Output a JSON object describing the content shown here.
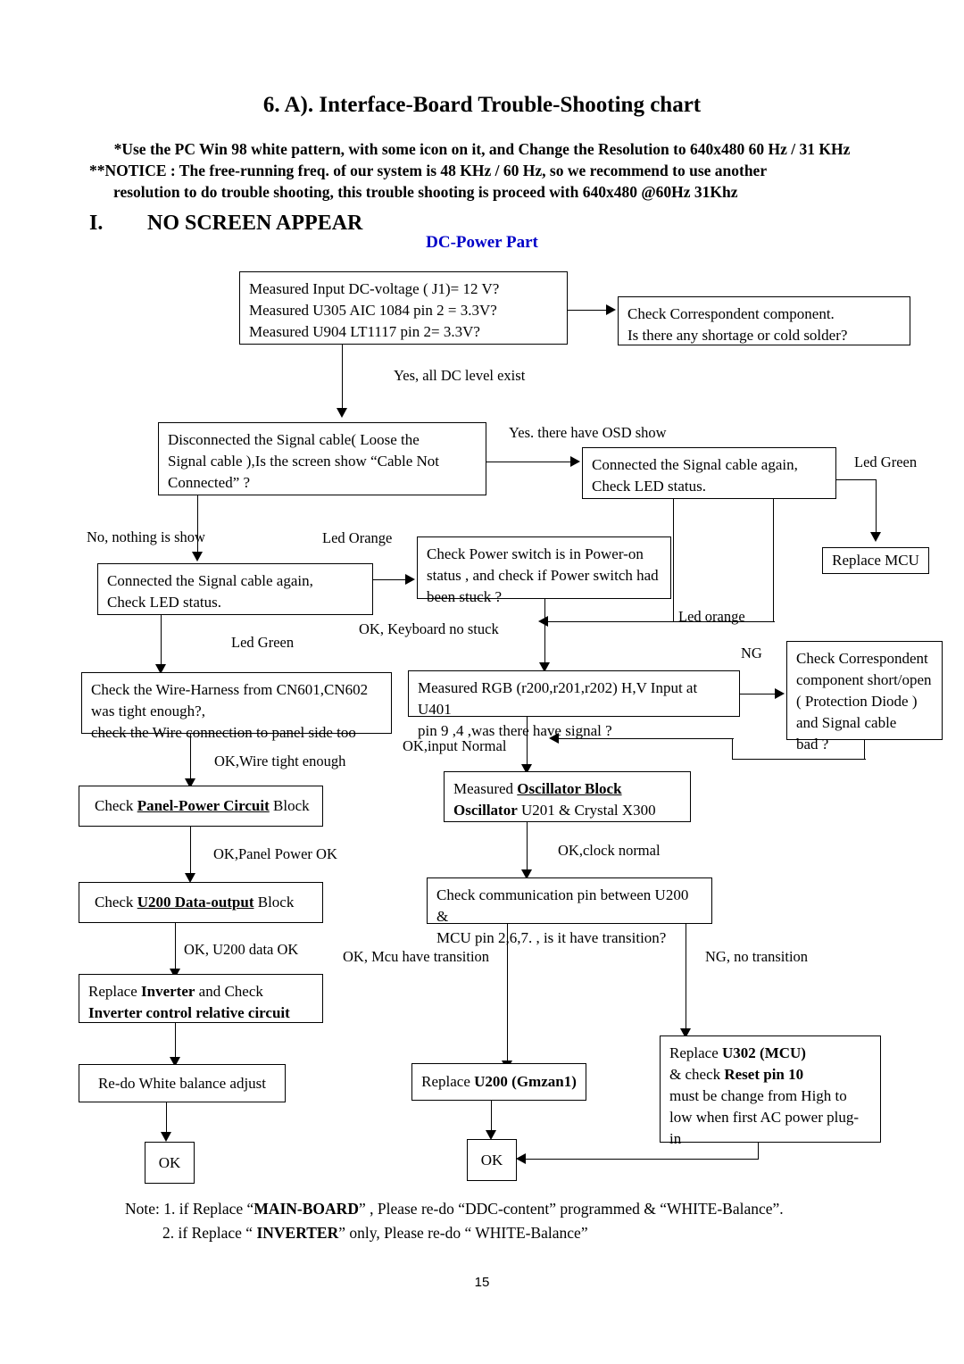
{
  "header": {
    "title": "6. A). Interface-Board Trouble-Shooting chart",
    "notice_line1": "*Use the PC Win 98 white pattern, with some icon on it, and Change the Resolution to 640x480 60 Hz / 31 KHz",
    "notice_line2": "**NOTICE : The free-running freq. of our system is 48 KHz / 60 Hz, so we recommend to use another",
    "notice_line3": "resolution to do trouble shooting, this trouble shooting is proceed with 640x480 @60Hz 31Khz",
    "section_number": "I.",
    "section_title": "NO SCREEN APPEAR",
    "subheading": "DC-Power Part",
    "subheading_color": "#0000c8"
  },
  "boxes": {
    "measured_input": {
      "line1": "Measured Input DC-voltage ( J1)= 12 V?",
      "line2": "Measured U305 AIC 1084 pin 2 = 3.3V?",
      "line3": "Measured U904 LT1117 pin 2= 3.3V?"
    },
    "check_correspondent": {
      "line1": "Check Correspondent component.",
      "line2": "Is there any shortage or cold solder?"
    },
    "disconnect_signal": {
      "line1": "Disconnected the Signal cable( Loose the",
      "line2": "Signal cable ),Is the screen show “Cable Not",
      "line3": "Connected” ?"
    },
    "connect_again_right": {
      "line1": "Connected the Signal cable again,",
      "line2": "Check LED status."
    },
    "replace_mcu": {
      "label": "Replace MCU"
    },
    "connect_again_left": {
      "line1": "Connected the Signal cable again,",
      "line2": "Check LED status."
    },
    "check_power_switch": {
      "line1": "Check Power switch is in Power-on",
      "line2": "status , and check if Power switch had",
      "line3": "been stuck ?"
    },
    "check_wire_harness": {
      "line1": "Check the Wire-Harness from CN601,CN602",
      "line2": "was tight enough?,",
      "line3": "check the Wire connection to panel side too"
    },
    "measured_rgb": {
      "line1": "Measured RGB (r200,r201,r202) H,V Input at U401",
      "line2": "pin 9 ,4 ,was there have signal ?"
    },
    "check_correspondent_short": {
      "line1": "Check Correspondent",
      "line2": "component short/open",
      "line3": " ( Protection Diode )",
      "line4": "and Signal cable",
      "line5": "bad ?"
    },
    "check_panel_power": {
      "prefix": "Check ",
      "emphasis": "Panel-Power Circuit",
      "suffix": " Block"
    },
    "measured_oscillator": {
      "line1_prefix": "Measured ",
      "line1_emphasis": "Oscillator Block",
      "line2_emphasis": "Oscillator",
      "line2_suffix": " U201 & Crystal X300"
    },
    "check_u200_data": {
      "prefix": "Check ",
      "emphasis": "U200 Data-output",
      "suffix": " Block"
    },
    "check_communication": {
      "line1": "Check communication pin between U200 &",
      "line2": "MCU pin 2,6,7. , is it have transition?"
    },
    "replace_inverter": {
      "line1_prefix": "Replace ",
      "line1_emphasis": "Inverter",
      "line1_suffix": " and Check",
      "line2_emphasis": "Inverter control relative circuit"
    },
    "replace_u302": {
      "line1_prefix": "Replace ",
      "line1_emphasis": "U302 (MCU)",
      "line2_prefix": "& check ",
      "line2_emphasis": "Reset pin 10",
      "line3": "must be change from High to",
      "line4": "low when first AC power plug-",
      "line5": "in"
    },
    "redo_white_balance": {
      "label": "Re-do White balance adjust"
    },
    "replace_u200": {
      "prefix": "Replace ",
      "emphasis": "U200 (Gmzan1)"
    },
    "ok_left": {
      "label": "OK"
    },
    "ok_mid": {
      "label": "OK"
    }
  },
  "edge_labels": {
    "yes_all_dc": "Yes, all DC level exist",
    "yes_osd": "Yes. there have OSD show",
    "led_green_right": "Led Green",
    "no_nothing": "No, nothing is show",
    "led_orange_top": "Led Orange",
    "led_green_left": "Led Green",
    "led_orange_return": "Led orange",
    "ok_keyboard": "OK, Keyboard no stuck",
    "ng_right": "NG",
    "ok_wire": "OK,Wire tight enough",
    "ok_input_normal": "OK,input Normal",
    "ok_panel_power": "OK,Panel Power OK",
    "ok_clock_normal": "OK,clock normal",
    "ok_u200_data": "OK, U200 data OK",
    "ok_mcu_transition": "OK, Mcu have transition",
    "ng_no_transition": "NG, no transition"
  },
  "footer": {
    "note_line1_a": "Note: 1. if Replace “",
    "note_line1_b": "MAIN-BOARD",
    "note_line1_c": "” , Please re-do “DDC-content” programmed & “WHITE-Balance”.",
    "note_line2_a": "2. if Replace “ ",
    "note_line2_b": "INVERTER",
    "note_line2_c": "” only, Please re-do “ WHITE-Balance”",
    "page_number": "15"
  }
}
